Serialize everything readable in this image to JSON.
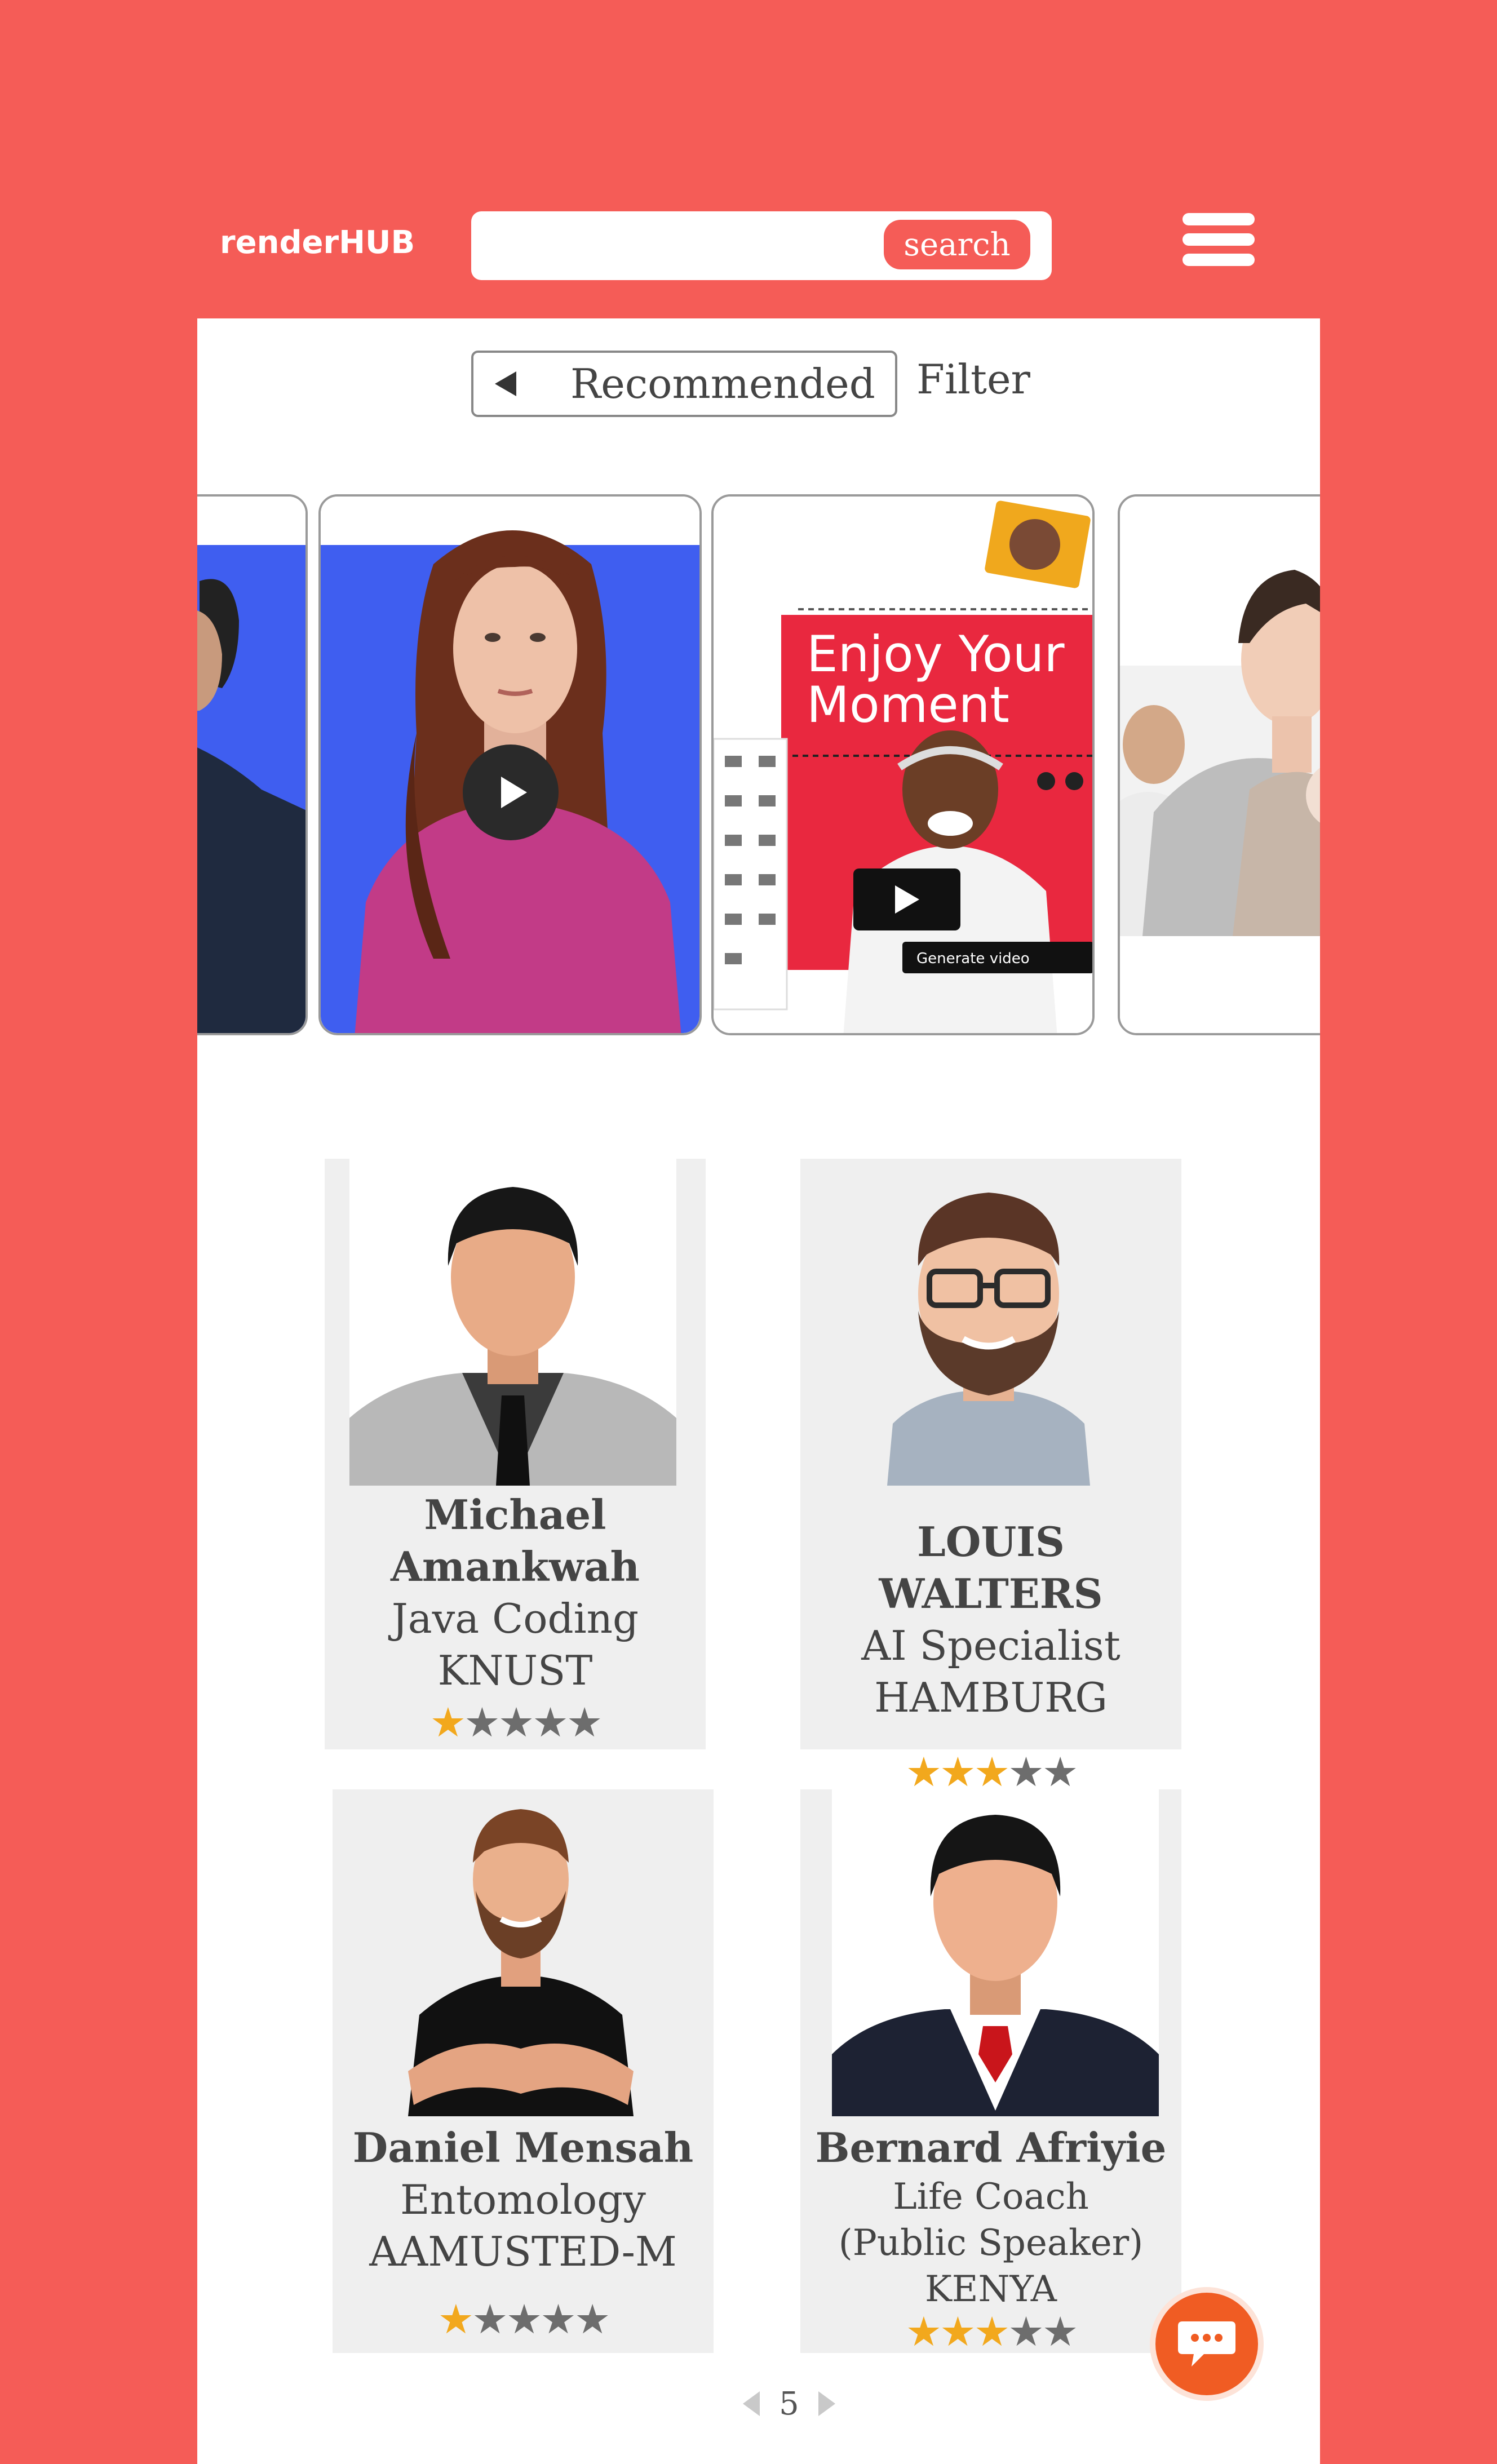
{
  "header": {
    "logo": "renderHUB",
    "search_placeholder": "",
    "search_button": "search"
  },
  "toolbar": {
    "recommended_label": "Recommended",
    "filter_label": "Filter"
  },
  "carousel": {
    "slide3": {
      "headline_line1": "Enjoy Your",
      "headline_line2": "Moment",
      "cta": "Generate video"
    }
  },
  "people": [
    {
      "name": "Michael Amankwah",
      "name_line1": "Michael",
      "name_line2": "Amankwah",
      "subject": "Java Coding",
      "location": "KNUST",
      "rating": 1,
      "max_rating": 5
    },
    {
      "name": "LOUIS WALTERS",
      "subject": "AI Specialist",
      "location": "HAMBURG",
      "rating": 3,
      "max_rating": 5
    },
    {
      "name": "Daniel Mensah",
      "subject": "Entomology",
      "location": "AAMUSTED-M",
      "rating": 1,
      "max_rating": 5
    },
    {
      "name": "Bernard Afriyie",
      "subject": "Life Coach",
      "subject_line2": "(Public Speaker)",
      "location": "KENYA",
      "rating": 3,
      "max_rating": 5
    }
  ],
  "pagination": {
    "current_page": "5"
  },
  "colors": {
    "brand": "#f55c57",
    "star": "#f2a81d",
    "chat": "#f05c23"
  },
  "icons": {
    "menu": "hamburger-menu-icon",
    "chat": "chat-bubble-icon",
    "play": "play-icon"
  }
}
